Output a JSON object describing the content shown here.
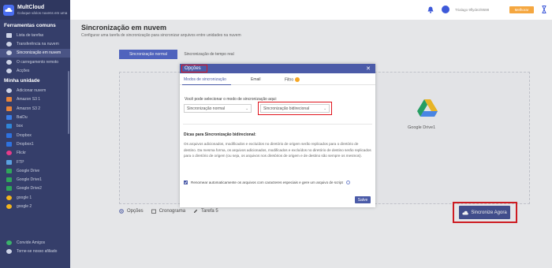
{
  "brand": {
    "name": "MultCloud",
    "tagline": "Coloque vários nuvens em uma"
  },
  "sidebar": {
    "sections": [
      {
        "title": "Ferramentas comuns",
        "items": [
          {
            "label": "Lista de tarefas",
            "icon": "task-list-icon"
          },
          {
            "label": "Transferência na nuvem",
            "icon": "cloud-transfer-icon"
          },
          {
            "label": "Sincronização em nuvem",
            "icon": "cloud-sync-icon",
            "active": true
          },
          {
            "label": "O carregamento remoto",
            "icon": "remote-upload-icon"
          },
          {
            "label": "Acções",
            "icon": "actions-icon"
          }
        ]
      },
      {
        "title": "Minha unidade",
        "items": [
          {
            "label": "Adicionar nuvem",
            "icon": "add-cloud-icon"
          },
          {
            "label": "Amazon S3 1",
            "icon": "amazon-s3-icon"
          },
          {
            "label": "Amazon S3 2",
            "icon": "amazon-s3-icon"
          },
          {
            "label": "BaiDu",
            "icon": "baidu-icon"
          },
          {
            "label": "box",
            "icon": "box-icon"
          },
          {
            "label": "Dropbox",
            "icon": "dropbox-icon"
          },
          {
            "label": "Dropbox1",
            "icon": "dropbox-icon"
          },
          {
            "label": "Flickr",
            "icon": "flickr-icon"
          },
          {
            "label": "FTP",
            "icon": "ftp-icon"
          },
          {
            "label": "Google Drive",
            "icon": "google-drive-icon"
          },
          {
            "label": "Google Drive1",
            "icon": "google-drive-icon"
          },
          {
            "label": "Google Drive2",
            "icon": "google-drive-icon"
          },
          {
            "label": "google 1",
            "icon": "google-photos-icon"
          },
          {
            "label": "google 2",
            "icon": "google-photos-icon"
          }
        ]
      }
    ],
    "bottom": [
      {
        "label": "Convide Amigos",
        "icon": "invite-icon"
      },
      {
        "label": "Torne-se nosso afiliado",
        "icon": "affiliate-icon"
      }
    ]
  },
  "topbar": {
    "user": "Trialago 9flyde2/9598",
    "upgrade": "Melhorar"
  },
  "main": {
    "title": "Sincronização em nuvem",
    "description": "Configurar uma tarefa de sincronização para sincronizar arquivos entre unidades na nuvem",
    "tabs": [
      "Sincronização normal",
      "Sincronização de tempo real"
    ],
    "target_cloud": "Google Drive1",
    "options": [
      "Opções",
      "Cronograma",
      "Tarefa 5"
    ],
    "sync_button": "Sincronize Agora"
  },
  "dialog": {
    "title": "Opções",
    "tabs": [
      "Modos de sincronização",
      "Email",
      "Filtro"
    ],
    "prompt": "Você pode selecionar o modo de sincronização aqui:",
    "select_left": "Sincronização normal",
    "select_right": "Sincronização bidirecional",
    "tips_title": "Dicas para Sincronização bidirecional:",
    "tips_text": "Os arquivos adicionados, modificados e excluídos no diretório de origem serão replicados para o diretório de destino. Da mesma forma, os arquivos adicionados, modificados e excluídos no diretório de destino serão replicados para o diretório de origem (ou seja, os arquivos nos diretórios de origem e de destino são sempre os mesmos).",
    "checkbox_label": "Renomear automaticamente os arquivos com caracteres especiais e gere um arquivo de script",
    "save": "Salve"
  },
  "colors": {
    "sidebar": "#353e6a",
    "accent": "#4b5ba8",
    "highlight": "#e0141d",
    "upgrade": "#f5a740"
  }
}
